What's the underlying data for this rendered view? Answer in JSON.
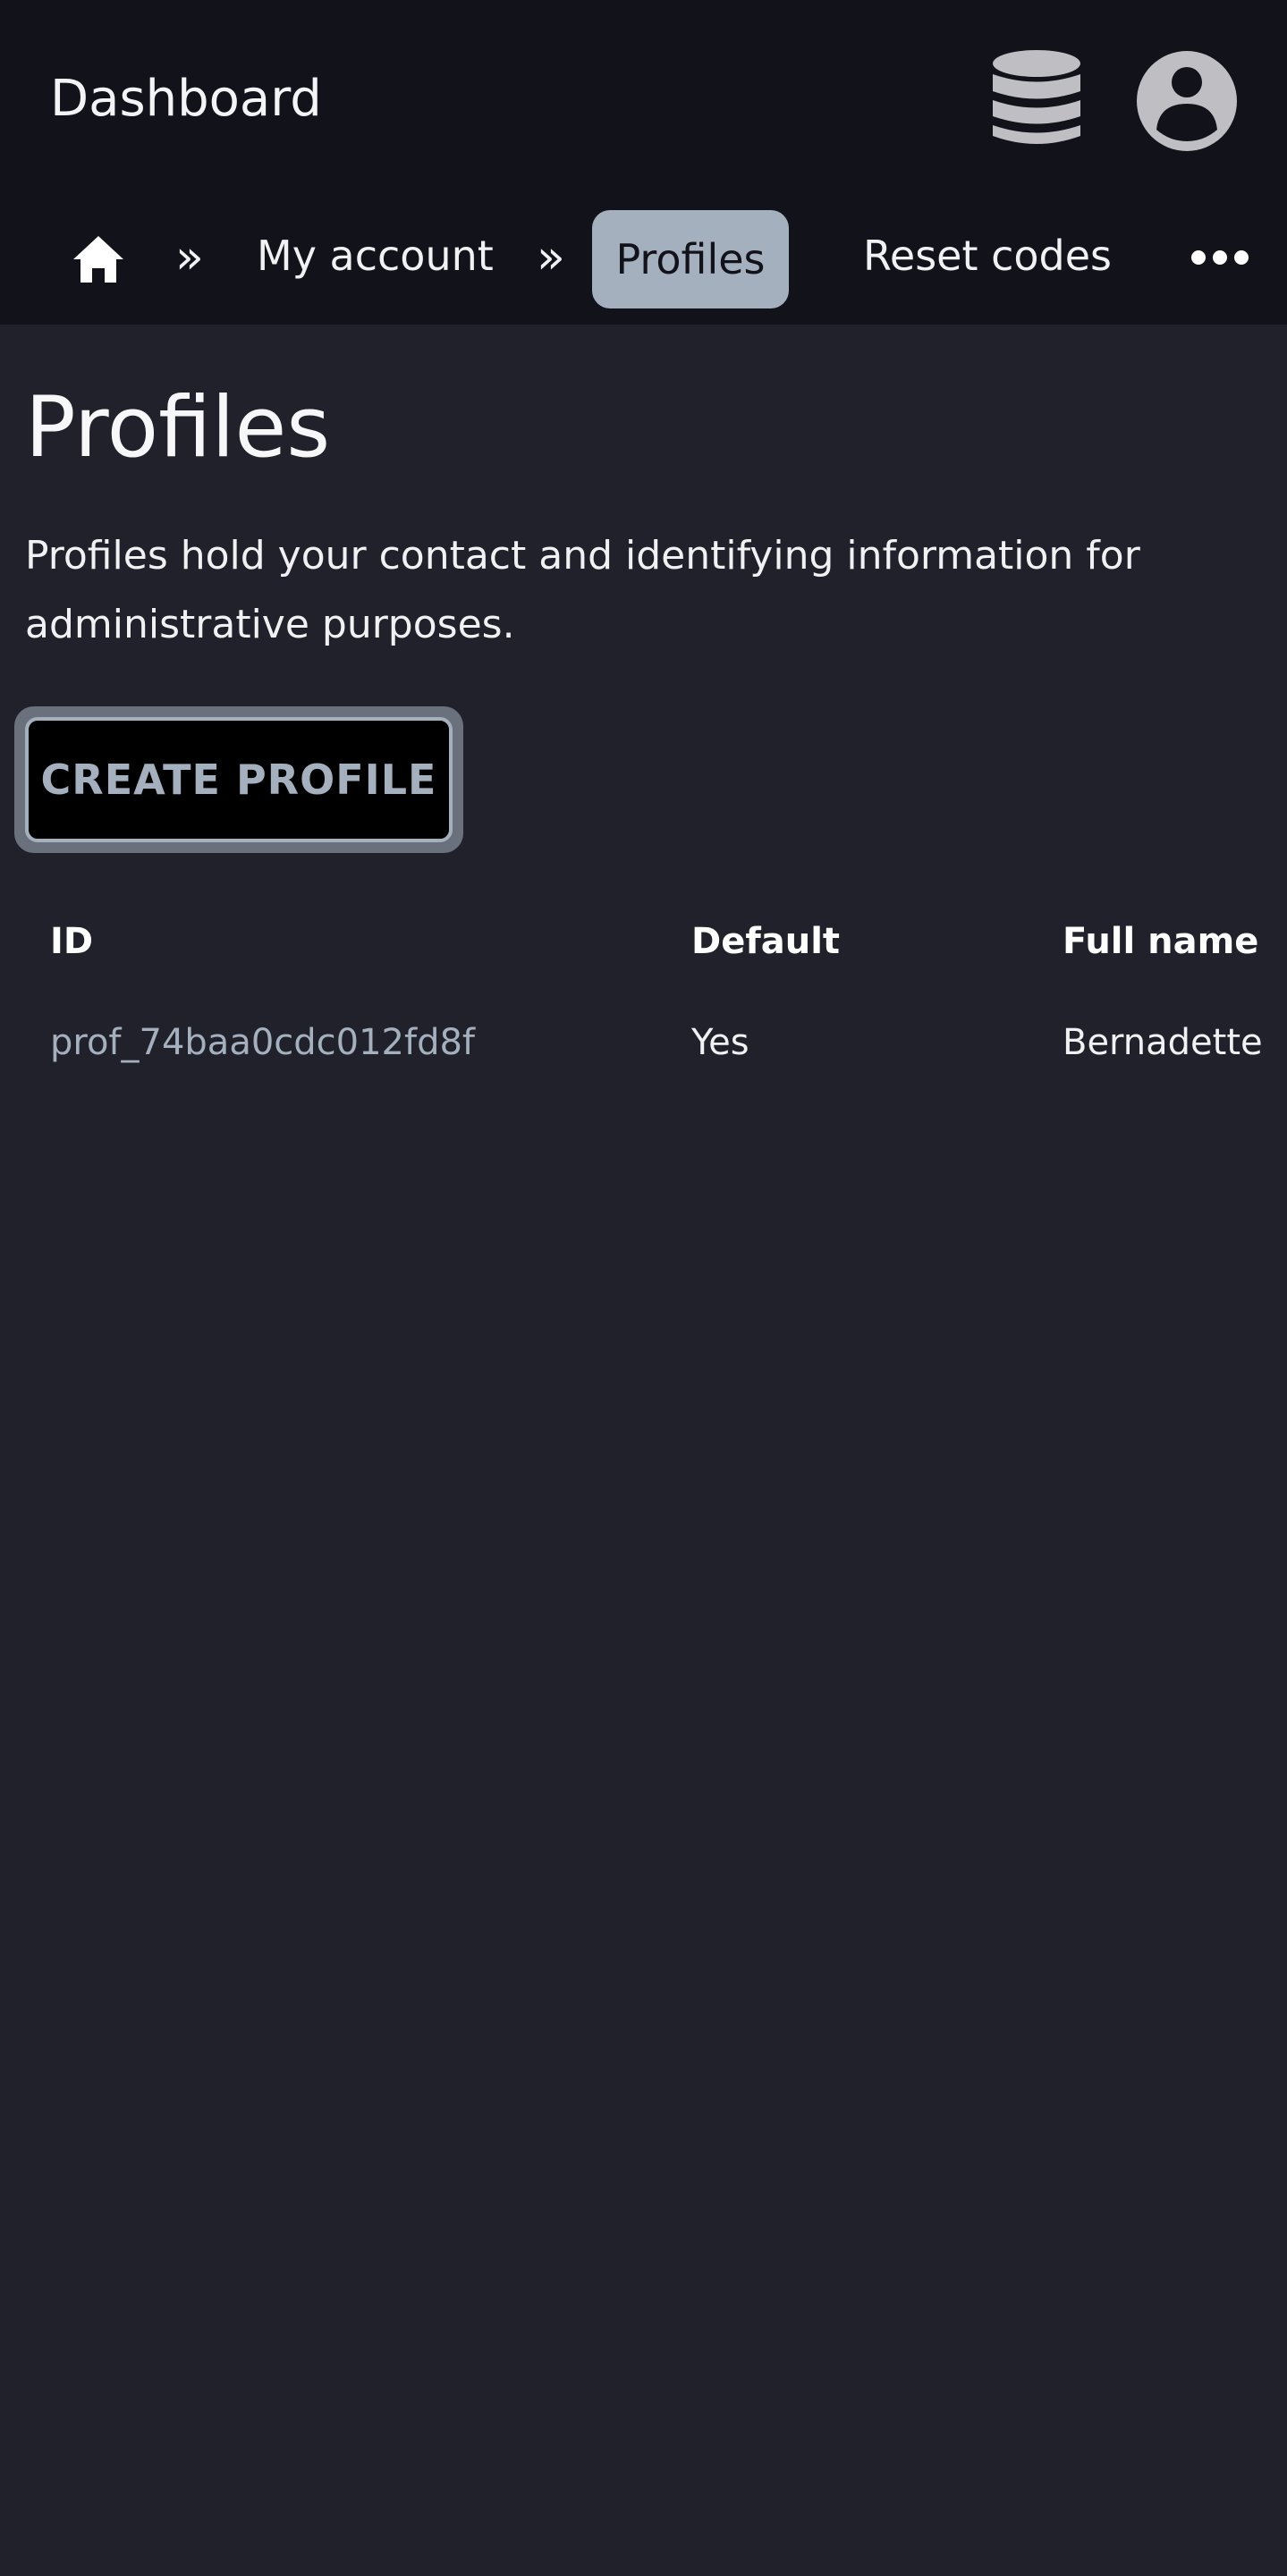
{
  "header": {
    "title": "Dashboard",
    "icons": [
      "database-icon",
      "user-account-icon"
    ]
  },
  "breadcrumb": {
    "home_icon": "home-icon",
    "separator": "»",
    "items": [
      {
        "label": "My account"
      },
      {
        "label": "Profiles",
        "active": true
      },
      {
        "label": "Reset codes"
      }
    ],
    "more_icon": "more-icon"
  },
  "page": {
    "title": "Profiles",
    "description": "Profiles hold your contact and identifying information for administrative purposes.",
    "create_button": "CREATE PROFILE"
  },
  "table": {
    "columns": [
      "ID",
      "Default",
      "Full name"
    ],
    "rows": [
      [
        "prof_74baa0cdc012fd8f",
        "Yes",
        "Bernadette"
      ]
    ]
  },
  "colors": {
    "background": "#21212b",
    "header_background": "#12121b",
    "accent": "#a5b0be",
    "text": "#ffffff"
  }
}
